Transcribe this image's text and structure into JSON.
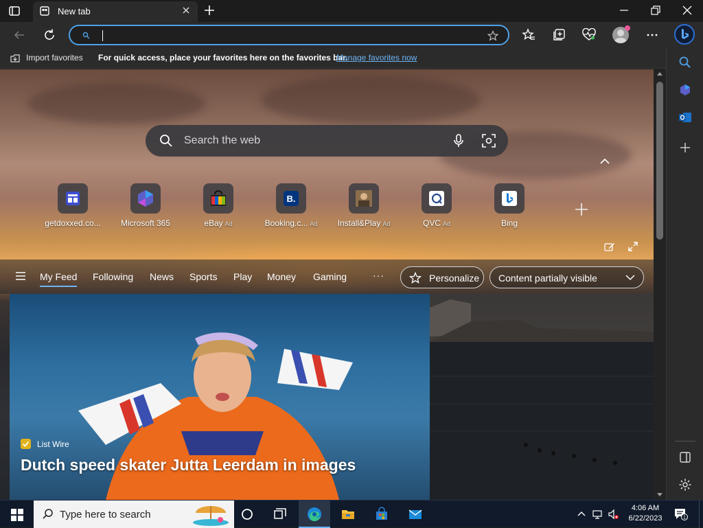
{
  "browser": {
    "tab": {
      "title": "New tab"
    },
    "addressbar": {
      "value": "",
      "placeholder": ""
    },
    "favorites_bar": {
      "import_label": "Import favorites",
      "message": "For quick access, place your favorites here on the favorites bar.",
      "link": "Manage favorites now"
    }
  },
  "newtab": {
    "search": {
      "placeholder": "Search the web"
    },
    "quick_links": [
      {
        "label": "getdoxxed.co...",
        "ad": "",
        "icon": "getdoxxed-icon",
        "color": "#3d4fd0"
      },
      {
        "label": "Microsoft 365",
        "ad": "",
        "icon": "microsoft-365-icon",
        "color": "#5b5fc7"
      },
      {
        "label": "eBay",
        "ad": "Ad",
        "icon": "ebay-icon",
        "color": "#e53238"
      },
      {
        "label": "Booking.c...",
        "ad": "Ad",
        "icon": "booking-icon",
        "color": "#003580"
      },
      {
        "label": "Install&Play",
        "ad": "Ad",
        "icon": "install-play-icon",
        "color": "#8a6d4b"
      },
      {
        "label": "QVC",
        "ad": "Ad",
        "icon": "qvc-icon",
        "color": "#ffffff"
      },
      {
        "label": "Bing",
        "ad": "",
        "icon": "bing-icon",
        "color": "#ffffff"
      }
    ],
    "feed_nav": {
      "tabs": [
        "My Feed",
        "Following",
        "News",
        "Sports",
        "Play",
        "Money",
        "Gaming"
      ],
      "active_tab": "My Feed",
      "more": "···",
      "personalize": "Personalize",
      "content_visibility": "Content partially visible"
    },
    "hero": {
      "source": "List Wire",
      "title": "Dutch speed skater Jutta Leerdam in images"
    }
  },
  "taskbar": {
    "search_placeholder": "Type here to search",
    "time": "4:06 AM",
    "date": "6/22/2023",
    "notification_count": "1"
  },
  "colors": {
    "accent": "#6cb4f5",
    "address_border": "#4ea2e8",
    "chrome": "#2b2b2b",
    "taskbar": "#101a2a"
  }
}
